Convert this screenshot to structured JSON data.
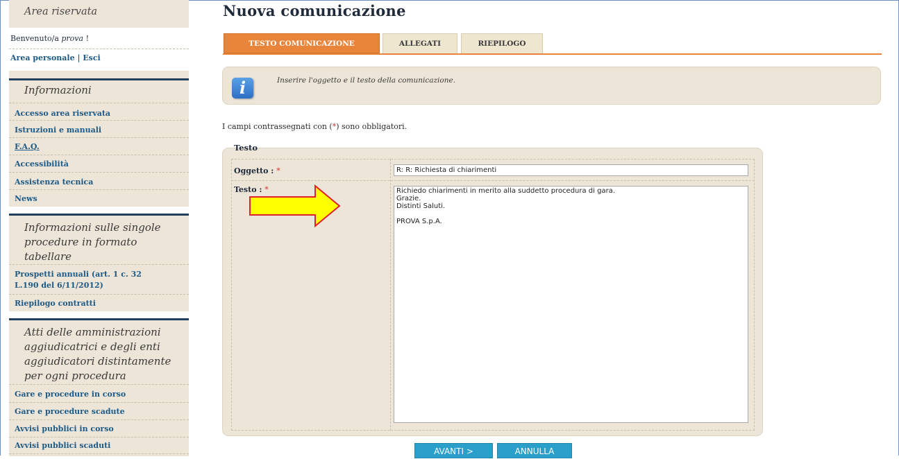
{
  "sidebar": {
    "reserved_title": "Area riservata",
    "welcome_prefix": "Benvenuto/a ",
    "welcome_user": "prova",
    "welcome_suffix": " !",
    "personal_area_link": "Area personale",
    "separator": " | ",
    "logout_link": "Esci",
    "info_title": "Informazioni",
    "info_items": [
      "Accesso area riservata",
      "Istruzioni e manuali",
      "F.A.Q.",
      "Accessibilità",
      "Assistenza tecnica",
      "News"
    ],
    "procedures_title_lines": [
      "Informazioni sulle singole",
      "procedure in formato",
      "tabellare"
    ],
    "procedures_items": [
      "Prospetti annuali (art. 1 c. 32",
      "L.190 del 6/11/2012)",
      "Riepilogo contratti"
    ],
    "acts_title_lines": [
      "Atti delle amministrazioni",
      "aggiudicatrici e degli enti",
      "aggiudicatori distintamente",
      "per ogni procedura"
    ],
    "acts_items": [
      "Gare e procedure in corso",
      "Gare e procedure scadute",
      "Avvisi pubblici in corso",
      "Avvisi pubblici scaduti"
    ]
  },
  "main": {
    "page_title": "Nuova comunicazione",
    "tabs": [
      {
        "label": "TESTO COMUNICAZIONE",
        "active": true
      },
      {
        "label": "ALLEGATI",
        "active": false
      },
      {
        "label": "RIEPILOGO",
        "active": false
      }
    ],
    "info_icon": "i",
    "info_text": "Inserire l'oggetto e il testo della comunicazione.",
    "required_note_prefix": "I campi contrassegnati con (",
    "required_star": "*",
    "required_note_suffix": ") sono obbligatori.",
    "fieldset_legend": "Testo",
    "subject_label": "Oggetto : ",
    "subject_value": "R: R: Richiesta di chiarimenti",
    "body_label": "Testo : ",
    "body_value": "Richiedo chiarimenti in merito alla suddetto procedura di gara.\nGrazie.\nDistinti Saluti.\n\nPROVA S.p.A.",
    "buttons": {
      "next": "AVANTI >",
      "cancel": "ANNULLA"
    }
  },
  "colors": {
    "accent_orange": "#e8853a",
    "sidebar_bg": "#ece5d8",
    "link_blue": "#1d5a87",
    "button_blue": "#2a9fc9",
    "arrow_yellow": "#ffff00",
    "arrow_outline": "#e0202a"
  },
  "icons": {
    "info": "info-icon",
    "arrow": "arrow-right-icon"
  }
}
